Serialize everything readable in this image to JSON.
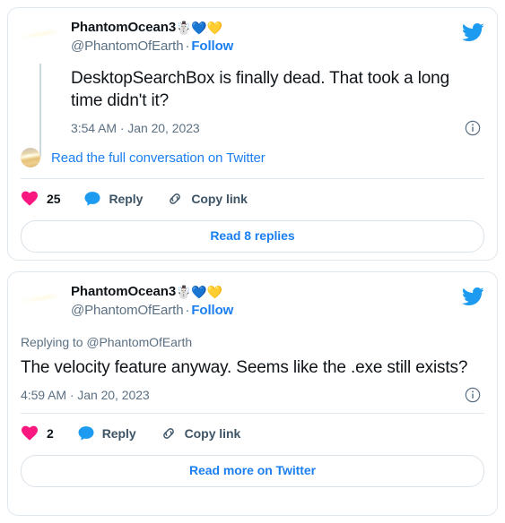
{
  "colors": {
    "brand_blue": "#1b7ff0",
    "twitter_bird_blue": "#1d9bf0",
    "like_pink": "#f91880",
    "reply_blue": "#1d9bf0",
    "text_primary": "#0f1419",
    "text_secondary": "#5b7083",
    "border": "#e1e8ed",
    "thread_line": "#ccd6dd",
    "background": "#ffffff"
  },
  "tweets": [
    {
      "id": "tweet-1",
      "author": {
        "display_name": "PhantomOcean3",
        "emojis": [
          "☃️",
          "💙",
          "💛"
        ],
        "handle": "@PhantomOfEarth",
        "separator": "·",
        "follow_label": "Follow",
        "avatar_alt": "saturn-planet-photo"
      },
      "brand_icon": "twitter-bird-icon",
      "text": "DesktopSearchBox is finally dead. That took a long time didn't it?",
      "timestamp": "3:54 AM · Jan 20, 2023",
      "info_icon": "info-circle-icon",
      "conversation_link": "Read the full conversation on Twitter",
      "actions": {
        "like": {
          "icon": "heart-icon",
          "count": "25"
        },
        "reply": {
          "icon": "reply-bubble-icon",
          "label": "Reply"
        },
        "copy": {
          "icon": "link-chain-icon",
          "label": "Copy link"
        }
      },
      "cta_label": "Read 8 replies"
    },
    {
      "id": "tweet-2",
      "author": {
        "display_name": "PhantomOcean3",
        "emojis": [
          "☃️",
          "💙",
          "💛"
        ],
        "handle": "@PhantomOfEarth",
        "separator": "·",
        "follow_label": "Follow",
        "avatar_alt": "saturn-planet-photo"
      },
      "brand_icon": "twitter-bird-icon",
      "replying_to": "Replying to @PhantomOfEarth",
      "text": "The velocity feature anyway. Seems like the .exe still exists?",
      "timestamp": "4:59 AM · Jan 20, 2023",
      "info_icon": "info-circle-icon",
      "actions": {
        "like": {
          "icon": "heart-icon",
          "count": "2"
        },
        "reply": {
          "icon": "reply-bubble-icon",
          "label": "Reply"
        },
        "copy": {
          "icon": "link-chain-icon",
          "label": "Copy link"
        }
      },
      "cta_label": "Read more on Twitter"
    }
  ]
}
